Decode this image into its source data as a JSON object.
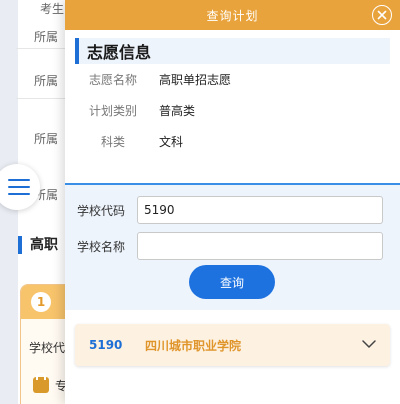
{
  "background": {
    "labels": [
      "考生",
      "所属",
      "所属",
      "所属",
      "所属"
    ],
    "section_title": "高职",
    "card": {
      "step": "1",
      "field_label": "学校代",
      "lock_text": "专"
    }
  },
  "modal": {
    "title": "查询计划",
    "info": {
      "title": "志愿信息",
      "rows": [
        {
          "key": "志愿名称",
          "value": "高职单招志愿"
        },
        {
          "key": "计划类别",
          "value": "普高类"
        },
        {
          "key": "科类",
          "value": "文科"
        }
      ]
    },
    "search": {
      "school_code_label": "学校代码",
      "school_code_value": "5190",
      "school_name_label": "学校名称",
      "school_name_value": "",
      "query_label": "查询"
    },
    "results": [
      {
        "code": "5190",
        "name": "四川城市职业学院"
      }
    ]
  },
  "colors": {
    "header": "#e9a33c",
    "accent_blue": "#1d72e0",
    "result_bg": "#fdf1e1",
    "result_name": "#e0952b"
  },
  "icons": [
    "menu-icon",
    "close-icon",
    "chevron-down-icon",
    "lock-icon"
  ]
}
